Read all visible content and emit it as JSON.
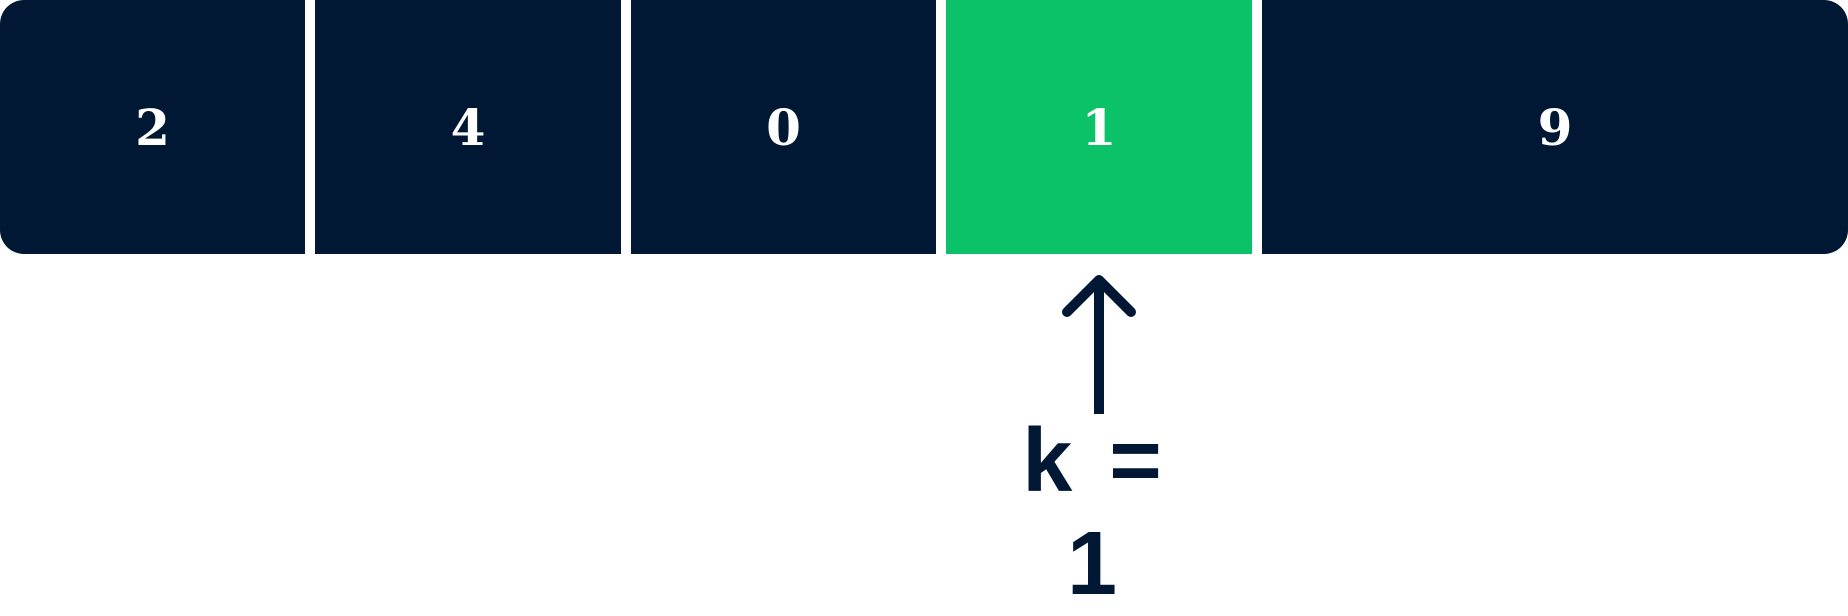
{
  "array": [
    {
      "value": "2",
      "highlighted": false
    },
    {
      "value": "4",
      "highlighted": false
    },
    {
      "value": "0",
      "highlighted": false
    },
    {
      "value": "1",
      "highlighted": true
    },
    {
      "value": "9",
      "highlighted": false
    }
  ],
  "pointer": {
    "label": "k = 1",
    "icon": "arrow-up-icon"
  },
  "colors": {
    "cell": "#001833",
    "highlight": "#0bc269",
    "text": "#ffffff"
  }
}
